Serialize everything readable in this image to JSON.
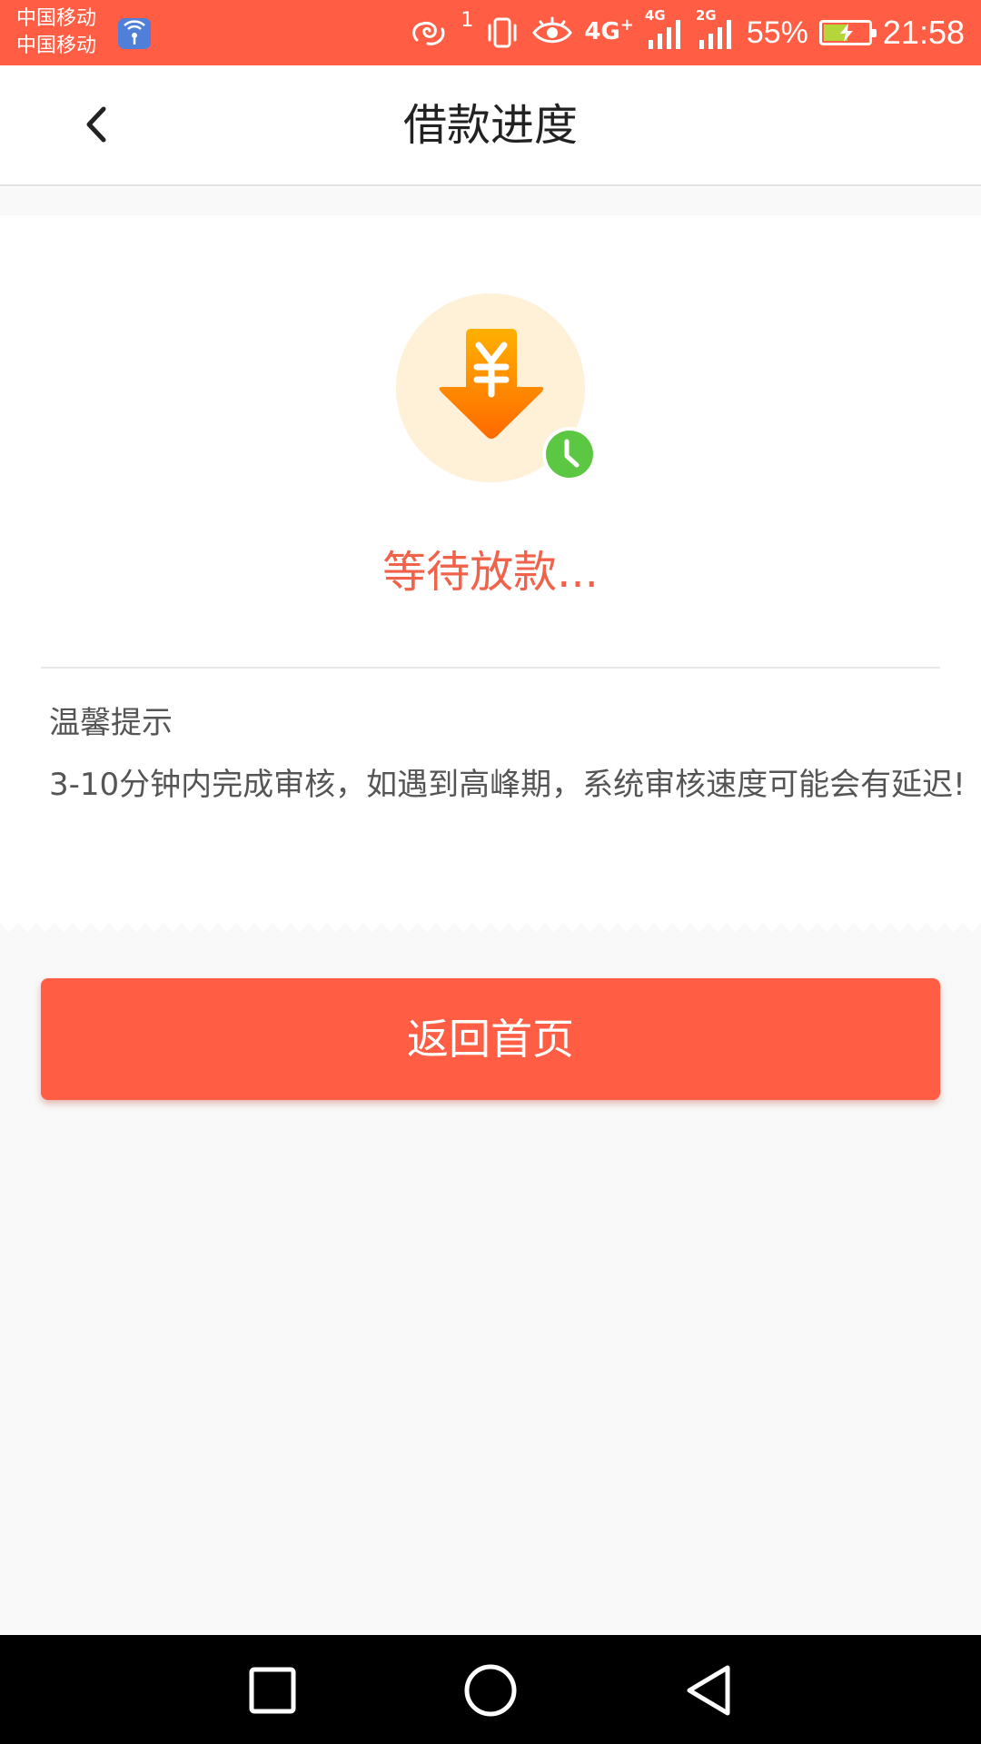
{
  "status_bar": {
    "carrier_1": "中国移动",
    "carrier_2": "中国移动",
    "sim_indicator": "1",
    "network_1": "4G",
    "network_1_small": "4G",
    "network_2": "2G",
    "battery_percent": "55%",
    "battery_level": 0.55,
    "time": "21:58",
    "icons": [
      "wifi-app-icon",
      "hd-call-icon",
      "vibrate-icon",
      "eye-icon",
      "signal-icon",
      "signal-icon",
      "battery-charging-icon"
    ]
  },
  "header": {
    "title": "借款进度",
    "back_icon": "chevron-left-icon"
  },
  "status": {
    "illustration_icon": "yuan-download-arrow-icon",
    "badge_icon": "clock-icon",
    "text": "等待放款..."
  },
  "tips": {
    "title": "温馨提示",
    "body": "3-10分钟内完成审核，如遇到高峰期，系统审核速度可能会有延迟!"
  },
  "actions": {
    "home_button_label": "返回首页"
  },
  "nav_bar": {
    "recent_icon": "square-icon",
    "home_icon": "circle-icon",
    "back_icon": "triangle-back-icon"
  },
  "colors": {
    "accent": "#ff5e45",
    "status_text": "#f0634a",
    "badge_green": "#5cc742",
    "illustration_bg": "#fff0d8",
    "arrow_orange": "#ff8a00"
  }
}
